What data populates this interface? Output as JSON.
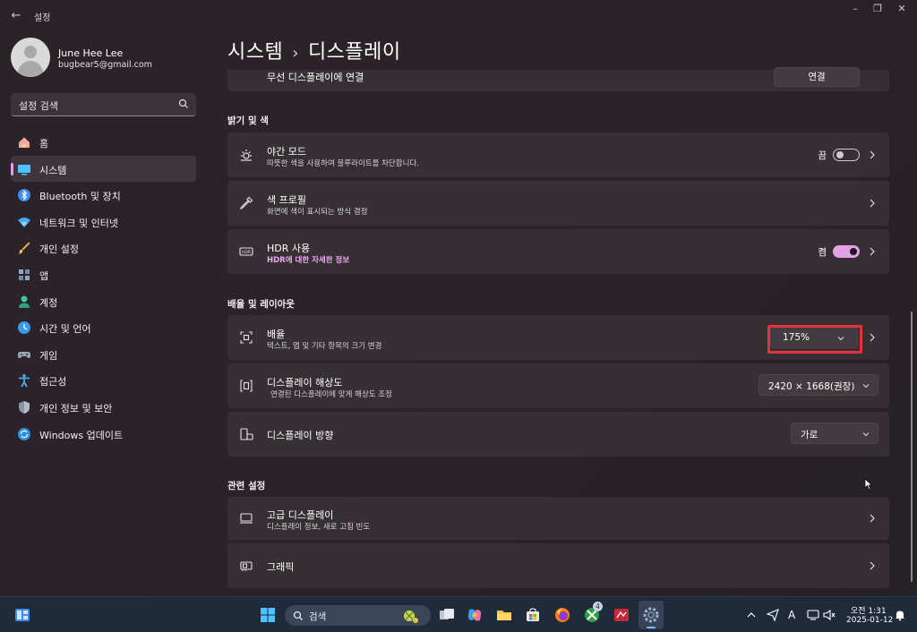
{
  "window": {
    "app_title": "설정",
    "back": "←",
    "controls": [
      "–",
      "❐",
      "✕"
    ]
  },
  "profile": {
    "name": "June Hee Lee",
    "email": "bugbear5@gmail.com"
  },
  "search": {
    "placeholder": "설정 검색"
  },
  "sidebar": {
    "items": [
      {
        "label": "홈",
        "icon": "home-icon"
      },
      {
        "label": "시스템",
        "icon": "system-icon",
        "active": true
      },
      {
        "label": "Bluetooth 및 장치",
        "icon": "bluetooth-icon"
      },
      {
        "label": "네트워크 및 인터넷",
        "icon": "network-icon"
      },
      {
        "label": "개인 설정",
        "icon": "brush-icon"
      },
      {
        "label": "앱",
        "icon": "apps-icon"
      },
      {
        "label": "계정",
        "icon": "account-icon"
      },
      {
        "label": "시간 및 언어",
        "icon": "time-language-icon"
      },
      {
        "label": "게임",
        "icon": "gaming-icon"
      },
      {
        "label": "접근성",
        "icon": "accessibility-icon"
      },
      {
        "label": "개인 정보 및 보안",
        "icon": "shield-icon"
      },
      {
        "label": "Windows 업데이트",
        "icon": "update-icon"
      }
    ]
  },
  "breadcrumb": {
    "parent": "시스템",
    "separator": "›",
    "current": "디스플레이"
  },
  "wireless": {
    "title": "무선 디스플레이에 연결",
    "button": "연결"
  },
  "sections": {
    "brightness": "밝기 및 색",
    "scale_layout": "배율 및 레이아웃",
    "related": "관련 설정"
  },
  "night_light": {
    "title": "야간 모드",
    "subtitle": "따뜻한 색을 사용하여 블루라이트를 차단합니다.",
    "state_label": "끔",
    "on": false
  },
  "color_profile": {
    "title": "색 프로필",
    "subtitle": "화면에 색이 표시되는 방식 결정"
  },
  "hdr": {
    "title": "HDR 사용",
    "link": "HDR에 대한 자세한 정보",
    "state_label": "켬",
    "on": true
  },
  "scale": {
    "title": "배율",
    "subtitle": "텍스트, 앱 및 기타 항목의 크기 변경",
    "value": "175%"
  },
  "resolution": {
    "title": "디스플레이 해상도",
    "subtitle": "연결된 디스플레이에 맞게 해상도 조정",
    "value": "2420 × 1668(권장)"
  },
  "orientation": {
    "title": "디스플레이 방향",
    "value": "가로"
  },
  "advanced_display": {
    "title": "고급 디스플레이",
    "subtitle": "디스플레이 정보, 새로 고침 빈도"
  },
  "graphics": {
    "title": "그래픽"
  },
  "taskbar": {
    "search_label": "검색",
    "xbox_badge": "4",
    "time": "오전 1:31",
    "date": "2025-01-12",
    "ime": "A"
  },
  "colors": {
    "accent": "#e2a0e6",
    "highlight": "#e8313a",
    "card": "#362f34",
    "taskbar": "#1f2a3b"
  }
}
